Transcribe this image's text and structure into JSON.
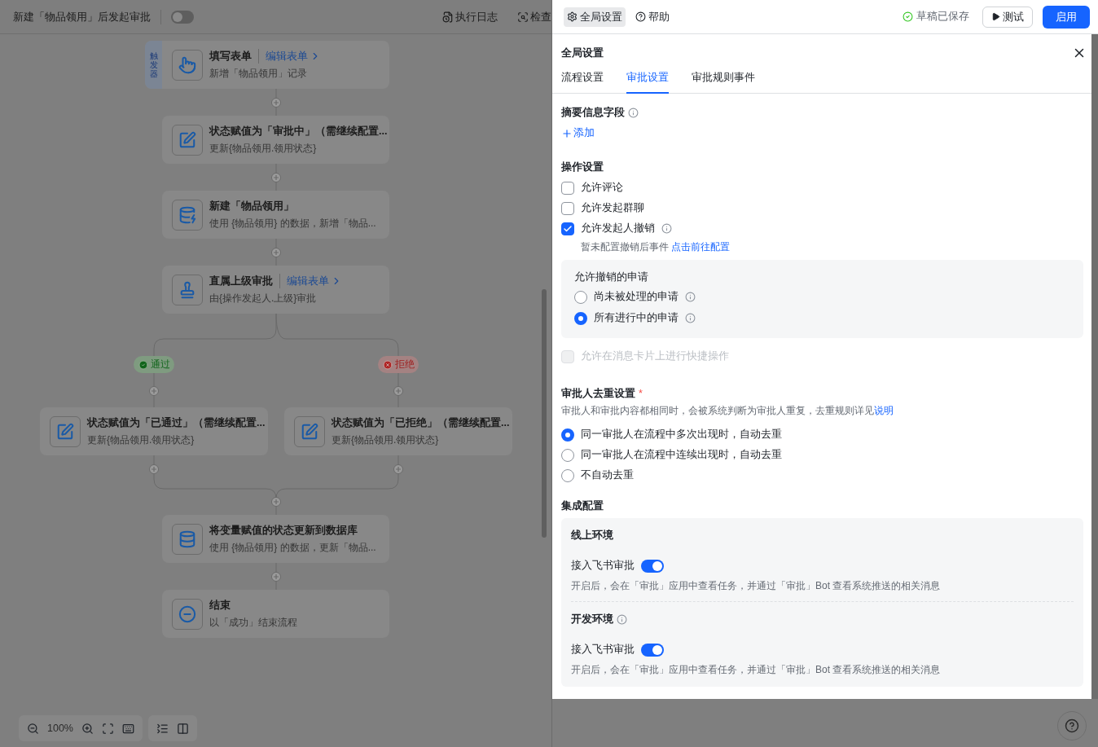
{
  "topbar": {
    "title": "新建「物品领用」后发起审批",
    "toggle_on": false,
    "actions": [
      {
        "kind": "log",
        "label": "执行日志"
      },
      {
        "kind": "check",
        "label": "检查"
      }
    ]
  },
  "flow": {
    "nodes": [
      {
        "kind": "trigger",
        "tag": "触发器",
        "title": "填写表单",
        "link": "编辑表单",
        "subtitle": "新增「物品领用」记录"
      },
      {
        "kind": "assign",
        "title": "状态赋值为「审批中」（需继续配置...",
        "subtitle": "更新{物品领用.领用状态}"
      },
      {
        "kind": "create",
        "title": "新建「物品领用」",
        "subtitle": "使用 {物品领用} 的数据，新增「物品..."
      },
      {
        "kind": "approval",
        "title": "直属上级审批",
        "link": "编辑表单",
        "subtitle": "由{操作发起人.上级}审批"
      }
    ],
    "branches": [
      {
        "kind": "approve",
        "label": "通过",
        "node": {
          "kind": "assign",
          "title": "状态赋值为「已通过」（需继续配置...",
          "subtitle": "更新{物品领用.领用状态}"
        }
      },
      {
        "kind": "reject",
        "label": "拒绝",
        "node": {
          "kind": "assign",
          "title": "状态赋值为「已拒绝」（需继续配置...",
          "subtitle": "更新{物品领用.领用状态}"
        }
      }
    ],
    "after": [
      {
        "kind": "update",
        "title": "将变量赋值的状态更新到数据库",
        "subtitle": "使用 {物品领用} 的数据，更新「物品..."
      },
      {
        "kind": "end",
        "title": "结束",
        "subtitle": "以「成功」结束流程"
      }
    ],
    "zoom": "100%"
  },
  "header": {
    "tabs": [
      {
        "kind": "settings",
        "label": "全局设置",
        "selected": true
      },
      {
        "kind": "help",
        "label": "帮助",
        "selected": false
      }
    ],
    "save_status": "草稿已保存",
    "test_button": "测试",
    "enable_button": "启用"
  },
  "drawer": {
    "title": "全局设置",
    "tabs": [
      {
        "label": "流程设置",
        "selected": false
      },
      {
        "label": "审批设置",
        "selected": true
      },
      {
        "label": "审批规则事件",
        "selected": false
      }
    ],
    "summary": {
      "label": "摘要信息字段",
      "add": "添加"
    },
    "operations": {
      "label": "操作设置",
      "options": [
        {
          "label": "允许评论",
          "checked": false,
          "disabled": false,
          "info": false
        },
        {
          "label": "允许发起群聊",
          "checked": false,
          "disabled": false,
          "info": false
        },
        {
          "label": "允许发起人撤销",
          "checked": true,
          "disabled": false,
          "info": true,
          "note": "暂未配置撤销后事件",
          "note_link": "点击前往配置",
          "sub": {
            "label": "允许撤销的申请",
            "options": [
              {
                "label": "尚未被处理的申请",
                "selected": false
              },
              {
                "label": "所有进行中的申请",
                "selected": true
              }
            ]
          }
        },
        {
          "label": "允许在消息卡片上进行快捷操作",
          "checked": false,
          "disabled": true,
          "info": false
        }
      ]
    },
    "dedupe": {
      "label": "审批人去重设置",
      "required_mark": "*",
      "description": "审批人和审批内容都相同时，会被系统判断为审批人重复，去重规则详见",
      "link": "说明",
      "options": [
        {
          "label": "同一审批人在流程中多次出现时，自动去重",
          "selected": true
        },
        {
          "label": "同一审批人在流程中连续出现时，自动去重",
          "selected": false
        },
        {
          "label": "不自动去重",
          "selected": false
        }
      ]
    },
    "integration": {
      "label": "集成配置",
      "environments": [
        {
          "name": "线上环境",
          "info": false,
          "setting": "接入飞书审批",
          "on": true,
          "description": "开启后，会在「审批」应用中查看任务，并通过「审批」Bot 查看系统推送的相关消息"
        },
        {
          "name": "开发环境",
          "info": true,
          "setting": "接入飞书审批",
          "on": true,
          "description": "开启后，会在「审批」应用中查看任务，并通过「审批」Bot 查看系统推送的相关消息"
        }
      ]
    }
  }
}
